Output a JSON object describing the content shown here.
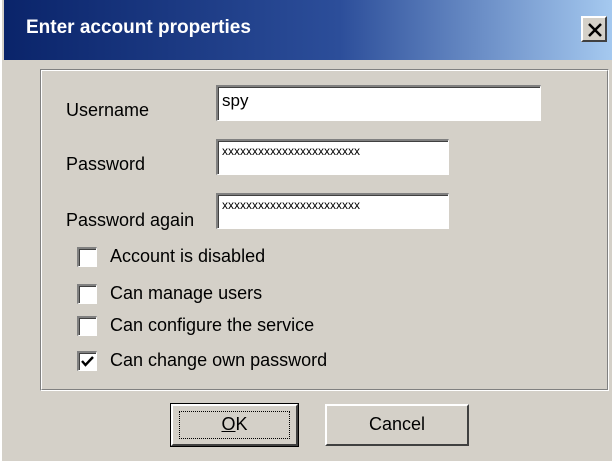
{
  "dialog": {
    "title": "Enter account properties"
  },
  "fields": {
    "username": {
      "label": "Username",
      "value": "spy"
    },
    "password": {
      "label": "Password",
      "value": "xxxxxxxxxxxxxxxxxxxxxxx"
    },
    "password_again": {
      "label": "Password again",
      "value": "xxxxxxxxxxxxxxxxxxxxxxx"
    }
  },
  "options": [
    {
      "label": "Account is disabled",
      "checked": false
    },
    {
      "label": "Can manage users",
      "checked": false
    },
    {
      "label": "Can configure the service",
      "checked": false
    },
    {
      "label": "Can change own password",
      "checked": true
    }
  ],
  "buttons": {
    "ok_mnemonic": "O",
    "ok_rest": "K",
    "cancel": "Cancel"
  },
  "icons": {
    "close": "close-icon",
    "check": "checkmark-icon"
  }
}
